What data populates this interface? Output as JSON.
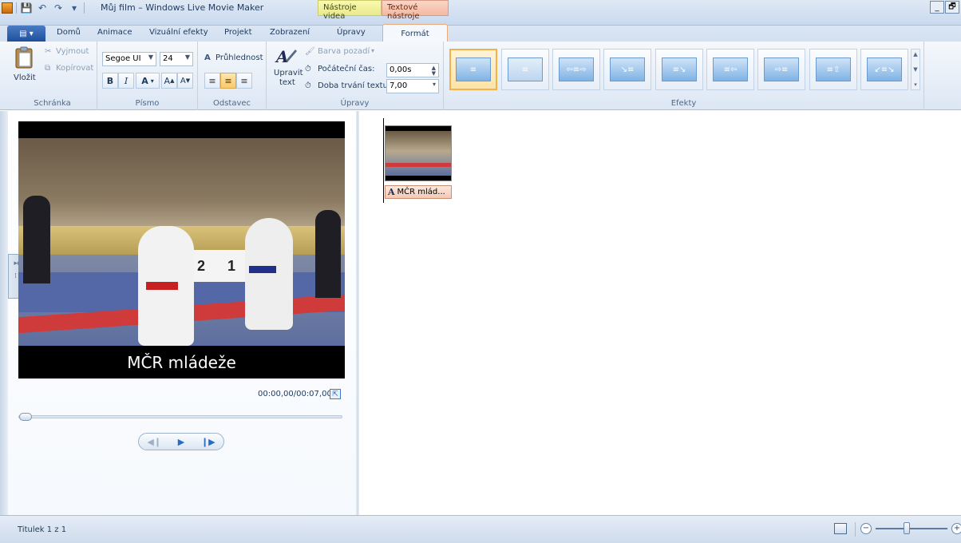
{
  "window": {
    "title": "Můj film – Windows Live Movie Maker",
    "context_tabs": {
      "video_tools": "Nástroje videa",
      "text_tools": "Textové nástroje"
    },
    "minimize": "_",
    "restore": "🗗"
  },
  "qat": {
    "save_icon": "💾",
    "undo_icon": "↶",
    "redo_icon": "↷",
    "customize_icon": "▾"
  },
  "tabs": {
    "file": "▤ ▾",
    "home": "Domů",
    "animations": "Animace",
    "visual_effects": "Vizuální efekty",
    "project": "Projekt",
    "view": "Zobrazení",
    "edit": "Úpravy",
    "format": "Formát"
  },
  "ribbon": {
    "clipboard": {
      "label": "Schránka",
      "paste": "Vložit",
      "cut": "Vyjmout",
      "copy": "Kopírovat"
    },
    "font": {
      "label": "Písmo",
      "family": "Segoe UI",
      "size": "24",
      "bold": "B",
      "italic": "I",
      "color": "A",
      "grow": "A",
      "shrink": "A",
      "transparency": "Průhlednost"
    },
    "paragraph": {
      "label": "Odstavec"
    },
    "adjust": {
      "label": "Úpravy",
      "edit_text_line1": "Upravit",
      "edit_text_line2": "text",
      "background_color": "Barva pozadí",
      "start_time_label": "Počáteční čas:",
      "start_time_value": "0,00s",
      "duration_label": "Doba trvání textu:",
      "duration_value": "7,00"
    },
    "effects": {
      "label": "Efekty"
    }
  },
  "preview": {
    "caption": "MČR mládeže",
    "podium_left": "2",
    "podium_right": "1",
    "timecode": "00:00,00/00:07,00",
    "seek_position": 0.0
  },
  "storyboard": {
    "clip_label": "MČR mlád...",
    "clip_icon": "A"
  },
  "status": {
    "text": "Titulek 1 z 1",
    "zoom_minus": "−",
    "zoom_plus": "+"
  },
  "colors": {
    "accent": "#2a6cc4",
    "selected_effect": "#f0b24a",
    "text_tools_tab": "#f3b9a3",
    "video_tools_tab": "#e9e98c"
  }
}
